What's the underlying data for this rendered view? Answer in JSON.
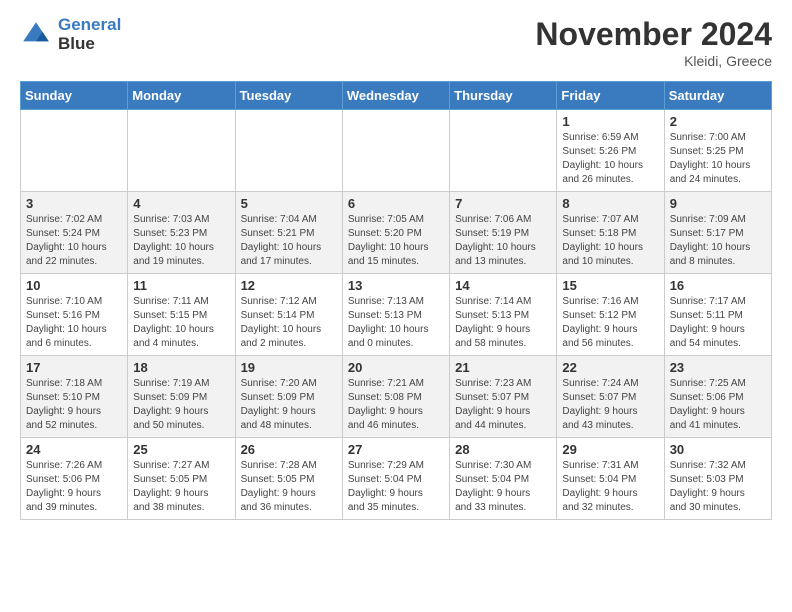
{
  "header": {
    "logo_line1": "General",
    "logo_line2": "Blue",
    "month": "November 2024",
    "location": "Kleidi, Greece"
  },
  "days_of_week": [
    "Sunday",
    "Monday",
    "Tuesday",
    "Wednesday",
    "Thursday",
    "Friday",
    "Saturday"
  ],
  "weeks": [
    [
      {
        "day": "",
        "info": ""
      },
      {
        "day": "",
        "info": ""
      },
      {
        "day": "",
        "info": ""
      },
      {
        "day": "",
        "info": ""
      },
      {
        "day": "",
        "info": ""
      },
      {
        "day": "1",
        "info": "Sunrise: 6:59 AM\nSunset: 5:26 PM\nDaylight: 10 hours\nand 26 minutes."
      },
      {
        "day": "2",
        "info": "Sunrise: 7:00 AM\nSunset: 5:25 PM\nDaylight: 10 hours\nand 24 minutes."
      }
    ],
    [
      {
        "day": "3",
        "info": "Sunrise: 7:02 AM\nSunset: 5:24 PM\nDaylight: 10 hours\nand 22 minutes."
      },
      {
        "day": "4",
        "info": "Sunrise: 7:03 AM\nSunset: 5:23 PM\nDaylight: 10 hours\nand 19 minutes."
      },
      {
        "day": "5",
        "info": "Sunrise: 7:04 AM\nSunset: 5:21 PM\nDaylight: 10 hours\nand 17 minutes."
      },
      {
        "day": "6",
        "info": "Sunrise: 7:05 AM\nSunset: 5:20 PM\nDaylight: 10 hours\nand 15 minutes."
      },
      {
        "day": "7",
        "info": "Sunrise: 7:06 AM\nSunset: 5:19 PM\nDaylight: 10 hours\nand 13 minutes."
      },
      {
        "day": "8",
        "info": "Sunrise: 7:07 AM\nSunset: 5:18 PM\nDaylight: 10 hours\nand 10 minutes."
      },
      {
        "day": "9",
        "info": "Sunrise: 7:09 AM\nSunset: 5:17 PM\nDaylight: 10 hours\nand 8 minutes."
      }
    ],
    [
      {
        "day": "10",
        "info": "Sunrise: 7:10 AM\nSunset: 5:16 PM\nDaylight: 10 hours\nand 6 minutes."
      },
      {
        "day": "11",
        "info": "Sunrise: 7:11 AM\nSunset: 5:15 PM\nDaylight: 10 hours\nand 4 minutes."
      },
      {
        "day": "12",
        "info": "Sunrise: 7:12 AM\nSunset: 5:14 PM\nDaylight: 10 hours\nand 2 minutes."
      },
      {
        "day": "13",
        "info": "Sunrise: 7:13 AM\nSunset: 5:13 PM\nDaylight: 10 hours\nand 0 minutes."
      },
      {
        "day": "14",
        "info": "Sunrise: 7:14 AM\nSunset: 5:13 PM\nDaylight: 9 hours\nand 58 minutes."
      },
      {
        "day": "15",
        "info": "Sunrise: 7:16 AM\nSunset: 5:12 PM\nDaylight: 9 hours\nand 56 minutes."
      },
      {
        "day": "16",
        "info": "Sunrise: 7:17 AM\nSunset: 5:11 PM\nDaylight: 9 hours\nand 54 minutes."
      }
    ],
    [
      {
        "day": "17",
        "info": "Sunrise: 7:18 AM\nSunset: 5:10 PM\nDaylight: 9 hours\nand 52 minutes."
      },
      {
        "day": "18",
        "info": "Sunrise: 7:19 AM\nSunset: 5:09 PM\nDaylight: 9 hours\nand 50 minutes."
      },
      {
        "day": "19",
        "info": "Sunrise: 7:20 AM\nSunset: 5:09 PM\nDaylight: 9 hours\nand 48 minutes."
      },
      {
        "day": "20",
        "info": "Sunrise: 7:21 AM\nSunset: 5:08 PM\nDaylight: 9 hours\nand 46 minutes."
      },
      {
        "day": "21",
        "info": "Sunrise: 7:23 AM\nSunset: 5:07 PM\nDaylight: 9 hours\nand 44 minutes."
      },
      {
        "day": "22",
        "info": "Sunrise: 7:24 AM\nSunset: 5:07 PM\nDaylight: 9 hours\nand 43 minutes."
      },
      {
        "day": "23",
        "info": "Sunrise: 7:25 AM\nSunset: 5:06 PM\nDaylight: 9 hours\nand 41 minutes."
      }
    ],
    [
      {
        "day": "24",
        "info": "Sunrise: 7:26 AM\nSunset: 5:06 PM\nDaylight: 9 hours\nand 39 minutes."
      },
      {
        "day": "25",
        "info": "Sunrise: 7:27 AM\nSunset: 5:05 PM\nDaylight: 9 hours\nand 38 minutes."
      },
      {
        "day": "26",
        "info": "Sunrise: 7:28 AM\nSunset: 5:05 PM\nDaylight: 9 hours\nand 36 minutes."
      },
      {
        "day": "27",
        "info": "Sunrise: 7:29 AM\nSunset: 5:04 PM\nDaylight: 9 hours\nand 35 minutes."
      },
      {
        "day": "28",
        "info": "Sunrise: 7:30 AM\nSunset: 5:04 PM\nDaylight: 9 hours\nand 33 minutes."
      },
      {
        "day": "29",
        "info": "Sunrise: 7:31 AM\nSunset: 5:04 PM\nDaylight: 9 hours\nand 32 minutes."
      },
      {
        "day": "30",
        "info": "Sunrise: 7:32 AM\nSunset: 5:03 PM\nDaylight: 9 hours\nand 30 minutes."
      }
    ]
  ]
}
